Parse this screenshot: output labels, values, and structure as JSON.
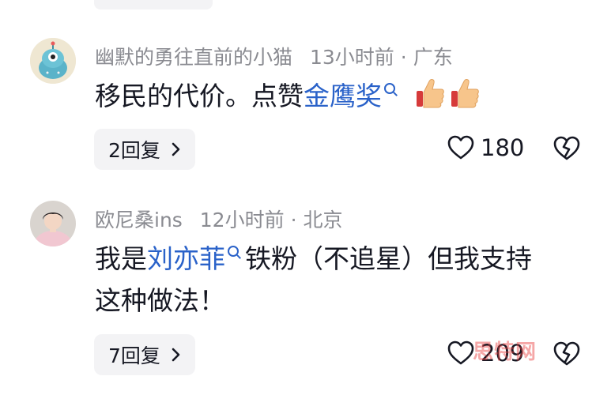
{
  "comments": [
    {
      "username": "幽默的勇往直前的小猫",
      "time": "13小时前",
      "separator": "·",
      "location": "广东",
      "text_before": "移民的代价。点赞",
      "linked_term": "金鹰奖",
      "text_after": "",
      "emojis": [
        "thumbs-up",
        "thumbs-up"
      ],
      "replies_label": "2回复",
      "like_count": "180"
    },
    {
      "username": "欧尼桑ins",
      "time": "12小时前",
      "separator": "·",
      "location": "北京",
      "text_before": "我是",
      "linked_term": "刘亦菲",
      "text_after": "铁粉（不追星）但我支持",
      "text_line2": "这种做法！",
      "replies_label": "7回复",
      "like_count": "209"
    }
  ],
  "watermark": "思特网",
  "colors": {
    "link": "#2a62c9",
    "meta": "#8a8b91",
    "reply_bg": "#f3f3f5"
  }
}
